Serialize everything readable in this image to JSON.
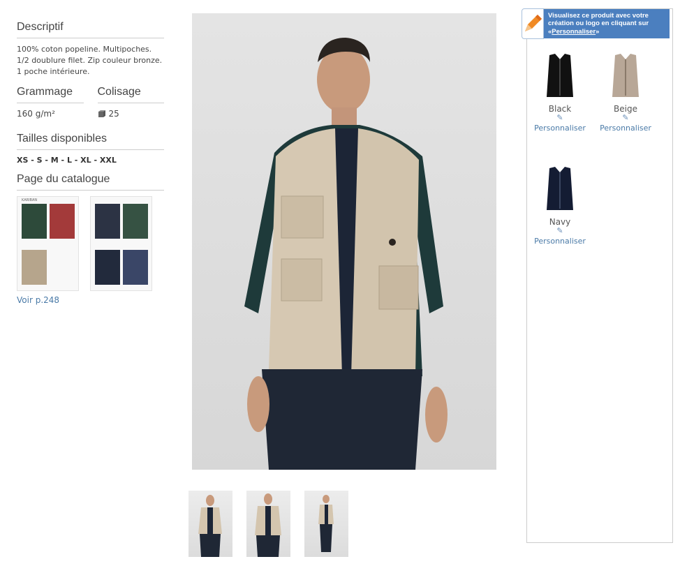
{
  "left": {
    "descriptif": {
      "title": "Descriptif",
      "text": "100% coton popeline. Multipoches. 1/2 doublure filet. Zip couleur bronze. 1 poche intérieure."
    },
    "grammage": {
      "title": "Grammage",
      "value": "160 g/m²"
    },
    "colisage": {
      "title": "Colisage",
      "value": "25",
      "icon": "box-icon"
    },
    "tailles": {
      "title": "Tailles disponibles",
      "sizes": "XS - S - M - L - XL - XXL"
    },
    "catalogue": {
      "title": "Page du catalogue",
      "link": "Voir p.248",
      "header_text": "KARIBAN"
    }
  },
  "main_image": {
    "alt": "Man wearing beige multi-pocket vest"
  },
  "thumbnails": [
    {
      "alt": "front view"
    },
    {
      "alt": "front view close"
    },
    {
      "alt": "walking view"
    }
  ],
  "right": {
    "banner": {
      "icon": "pencil-icon",
      "text": "Visualisez ce produit avec votre création ou logo en cliquant sur «",
      "link": "Personnaliser",
      "close": "»"
    },
    "variants": [
      {
        "name": "Black",
        "color": "#111111",
        "pencil": "✎",
        "link": "Personnaliser"
      },
      {
        "name": "Beige",
        "color": "#b8a797",
        "pencil": "✎",
        "link": "Personnaliser"
      },
      {
        "name": "Navy",
        "color": "#141c33",
        "pencil": "✎",
        "link": "Personnaliser"
      }
    ]
  }
}
